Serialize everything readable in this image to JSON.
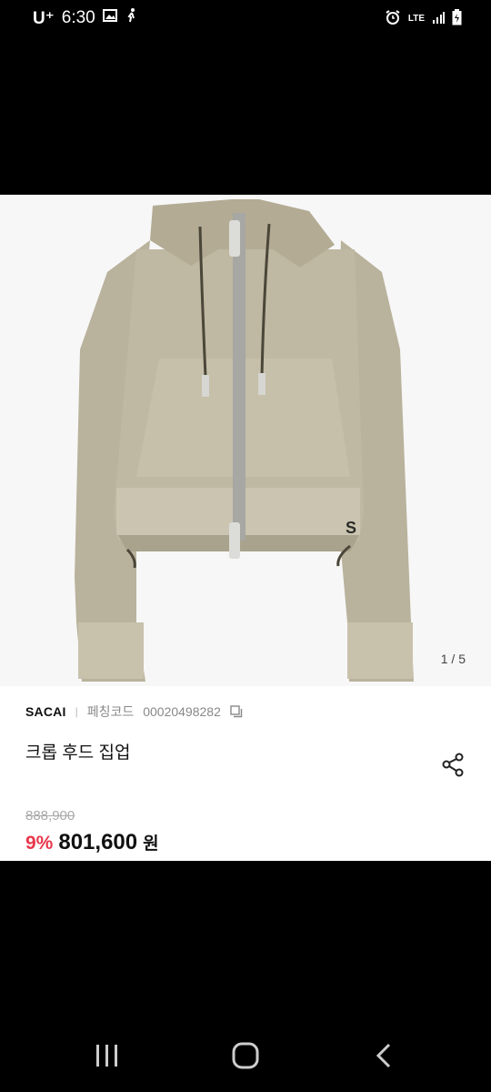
{
  "status_bar": {
    "carrier": "U⁺",
    "time": "6:30",
    "network": "LTE"
  },
  "product": {
    "pager": "1 / 5",
    "brand": "SACAI",
    "separator": "|",
    "code_label": "페칭코드",
    "code": "00020498282",
    "title": "크롭 후드 집업",
    "original_price": "888,900",
    "discount": "9%",
    "price": "801,600",
    "currency": "원"
  },
  "colors": {
    "accent_discount": "#e8374b",
    "jacket": "#bcb59f",
    "background": "#000000"
  },
  "icons": [
    "image-icon",
    "walk-icon",
    "alarm-icon",
    "signal-icon",
    "battery-icon",
    "copy-icon",
    "share-icon",
    "recents-icon",
    "home-icon",
    "back-icon"
  ]
}
